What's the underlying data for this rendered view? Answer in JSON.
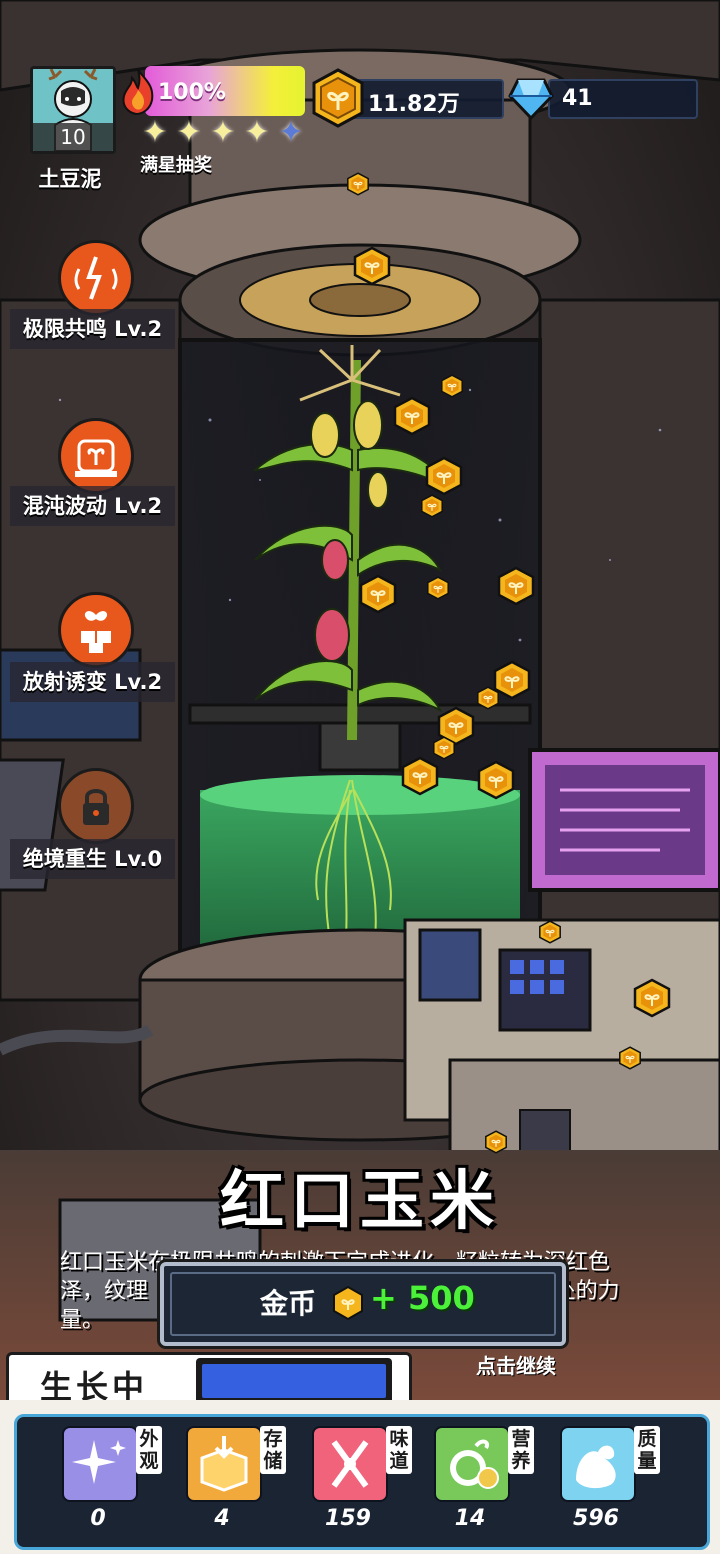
{
  "player": {
    "level": "10",
    "name": "土豆泥"
  },
  "energy": {
    "percent_text": "100%",
    "fill": 1.0
  },
  "stars": {
    "filled": 4,
    "total": 5,
    "label": "满星抽奖"
  },
  "currency": {
    "coins": "11.82万",
    "gems": "41"
  },
  "skills": [
    {
      "label": "极限共鸣 Lv.2",
      "icon": "resonance-icon"
    },
    {
      "label": "混沌波动 Lv.2",
      "icon": "chaos-wave-icon"
    },
    {
      "label": "放射诱变 Lv.2",
      "icon": "radiation-mutation-icon"
    },
    {
      "label": "绝境重生 Lv.0",
      "icon": "lock-icon"
    }
  ],
  "item": {
    "title": "红口玉米",
    "description_lines": [
      "红口玉米在极限共鸣的刺激下完成进化，籽粒转为深红色",
      "泽，纹理                                                          处的力",
      "量。"
    ]
  },
  "reward": {
    "label": "金币",
    "amount": "+ 500"
  },
  "continue_hint": "点击继续",
  "status": {
    "label": "生长中",
    "progress": 1.0
  },
  "stats": [
    {
      "tag": "外观",
      "value": "0",
      "icon": "sparkle-icon",
      "color": "#9a8fe6"
    },
    {
      "tag": "存储",
      "value": "4",
      "icon": "box-icon",
      "color": "#f2a93b"
    },
    {
      "tag": "味道",
      "value": "159",
      "icon": "utensils-icon",
      "color": "#f0637b"
    },
    {
      "tag": "营养",
      "value": "14",
      "icon": "fruit-icon",
      "color": "#78c95a"
    },
    {
      "tag": "质量",
      "value": "596",
      "icon": "muscle-icon",
      "color": "#7ed3f0"
    }
  ],
  "colors": {
    "accent_coin": "#f4b61c",
    "skill": "#e8571b",
    "reward_amount": "#4cf23a",
    "progress": "#3560e0"
  }
}
